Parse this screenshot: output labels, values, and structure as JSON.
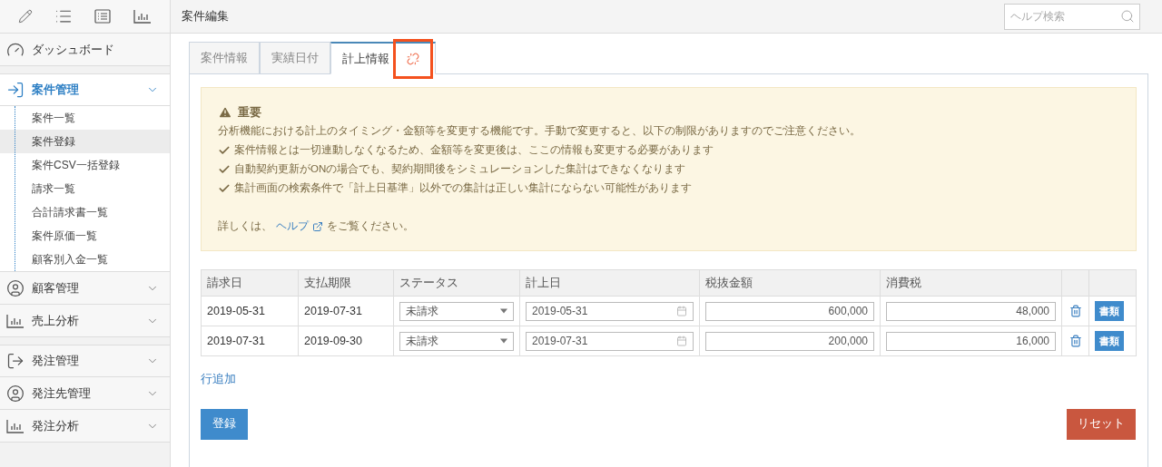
{
  "sidebar": {
    "sections": [
      {
        "kind": "dashboard",
        "label": "ダッシュボード",
        "group_start": false
      },
      {
        "kind": "login",
        "label": "案件管理",
        "expanded": true,
        "group_start": true,
        "selected": true,
        "children": [
          {
            "label": "案件一覧",
            "selected": false
          },
          {
            "label": "案件登録",
            "selected": true
          },
          {
            "label": "案件CSV一括登録",
            "selected": false
          },
          {
            "label": "請求一覧",
            "selected": false
          },
          {
            "label": "合計請求書一覧",
            "selected": false
          },
          {
            "label": "案件原価一覧",
            "selected": false
          },
          {
            "label": "顧客別入金一覧",
            "selected": false
          }
        ]
      },
      {
        "kind": "user",
        "label": "顧客管理",
        "expanded": false,
        "group_start": false,
        "selected": false
      },
      {
        "kind": "chart",
        "label": "売上分析",
        "expanded": false,
        "group_start": false,
        "selected": false
      },
      {
        "kind": "logout",
        "label": "発注管理",
        "expanded": false,
        "group_start": true,
        "selected": false
      },
      {
        "kind": "user",
        "label": "発注先管理",
        "expanded": false,
        "group_start": false,
        "selected": false
      },
      {
        "kind": "chart",
        "label": "発注分析",
        "expanded": false,
        "group_start": false,
        "selected": false
      }
    ]
  },
  "header": {
    "title": "案件編集",
    "search": {
      "placeholder": "ヘルプ検索"
    }
  },
  "tabs": [
    {
      "label": "案件情報",
      "selected": false,
      "unlinked": false
    },
    {
      "label": "実績日付",
      "selected": false,
      "unlinked": false
    },
    {
      "label": "計上情報",
      "selected": true,
      "unlinked": true
    }
  ],
  "alert": {
    "title": "重要",
    "intro": "分析機能における計上のタイミング・金額等を変更する機能です。手動で変更すると、以下の制限がありますのでご注意ください。",
    "points": [
      "案件情報とは一切連動しなくなるため、金額等を変更後は、ここの情報も変更する必要があります",
      "自動契約更新がONの場合でも、契約期間後をシミュレーションした集計はできなくなります",
      "集計画面の検索条件で「計上日基準」以外での集計は正しい集計にならない可能性があります"
    ],
    "help_before": "詳しくは、",
    "help_link": "ヘルプ",
    "help_after": "をご覧ください。"
  },
  "table": {
    "columns": [
      "請求日",
      "支払期限",
      "ステータス",
      "計上日",
      "税抜金額",
      "消費税"
    ],
    "rows": [
      {
        "billing_date": "2019-05-31",
        "due_date": "2019-07-31",
        "status": "未請求",
        "booking_date": "2019-05-31",
        "amount": "600,000",
        "tax": "48,000",
        "doc_button": "書類"
      },
      {
        "billing_date": "2019-07-31",
        "due_date": "2019-09-30",
        "status": "未請求",
        "booking_date": "2019-07-31",
        "amount": "200,000",
        "tax": "16,000",
        "doc_button": "書類"
      }
    ]
  },
  "add_row_link": "行追加",
  "buttons": {
    "submit": "登録",
    "reset": "リセット"
  }
}
